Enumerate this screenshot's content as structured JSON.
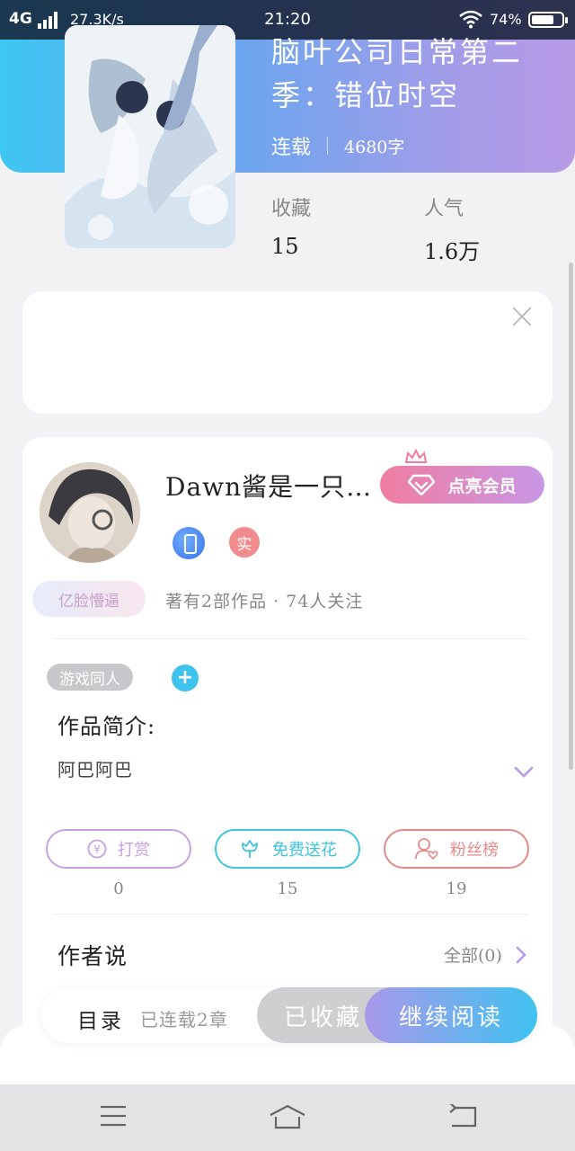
{
  "status_bar": {
    "network": "4G",
    "speed": "27.3K/s",
    "time": "21:20",
    "battery": "74%",
    "battery_level": 0.74
  },
  "book": {
    "title": "脑叶公司日常第二季：错位时空",
    "status": "连载",
    "word_count": "4680字",
    "stats": [
      {
        "label": "收藏",
        "value": "15"
      },
      {
        "label": "人气",
        "value": "1.6万"
      }
    ]
  },
  "author": {
    "name": "Dawn酱是一只…",
    "vip_label": "点亮会员",
    "real_badge": "实",
    "user_tag": "亿脸懵逼",
    "works_info": "著有2部作品 · 74人关注"
  },
  "intro": {
    "genre_tag": "游戏同人",
    "heading": "作品简介:",
    "text": "阿巴阿巴"
  },
  "actions": [
    {
      "label": "打赏",
      "count": "0",
      "color": "#c9a0e4",
      "icon": "yen-coin-icon"
    },
    {
      "label": "免费送花",
      "count": "15",
      "color": "#3ec3e0",
      "icon": "flower-icon"
    },
    {
      "label": "粉丝榜",
      "count": "19",
      "color": "#e58a8a",
      "icon": "fan-user-icon"
    }
  ],
  "author_say": {
    "heading": "作者说",
    "all_label": "全部(0)"
  },
  "bottom_bar": {
    "toc_label": "目录",
    "toc_count": "已连载2章",
    "collected_label": "已收藏",
    "read_label": "继续阅读"
  },
  "colors": {
    "accent_blue": "#3ec6f2",
    "accent_purple": "#b79ae6",
    "vip_pink": "#f07da0"
  }
}
